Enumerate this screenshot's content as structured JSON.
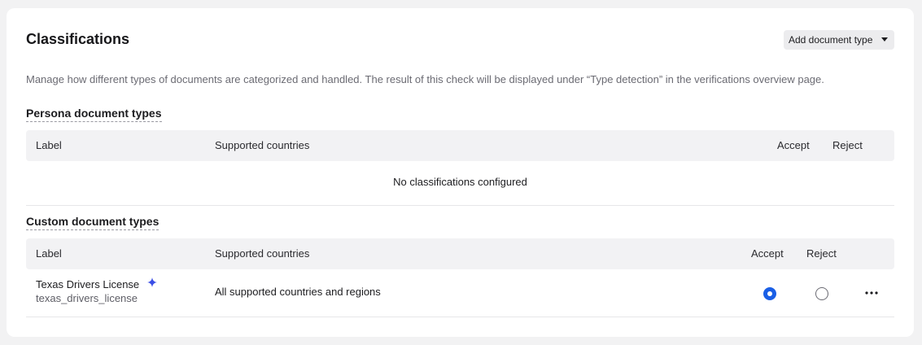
{
  "page": {
    "title": "Classifications",
    "add_button_label": "Add document type",
    "description": "Manage how different types of documents are categorized and handled. The result of this check will be displayed under “Type detection” in the verifications overview page."
  },
  "persona_section": {
    "title": "Persona document types",
    "columns": {
      "label": "Label",
      "supported_countries": "Supported countries",
      "accept": "Accept",
      "reject": "Reject"
    },
    "empty_message": "No classifications configured"
  },
  "custom_section": {
    "title": "Custom document types",
    "columns": {
      "label": "Label",
      "supported_countries": "Supported countries",
      "accept": "Accept",
      "reject": "Reject"
    },
    "rows": [
      {
        "label": "Texas Drivers License",
        "key": "texas_drivers_license",
        "supported_countries": "All supported countries and regions",
        "selection": "accept",
        "label_icon": "sparkle-icon",
        "actions_icon": "more-horizontal-icon"
      }
    ]
  },
  "colors": {
    "accent": "#1a5fe6",
    "sparkle": "#3b4ee6"
  }
}
